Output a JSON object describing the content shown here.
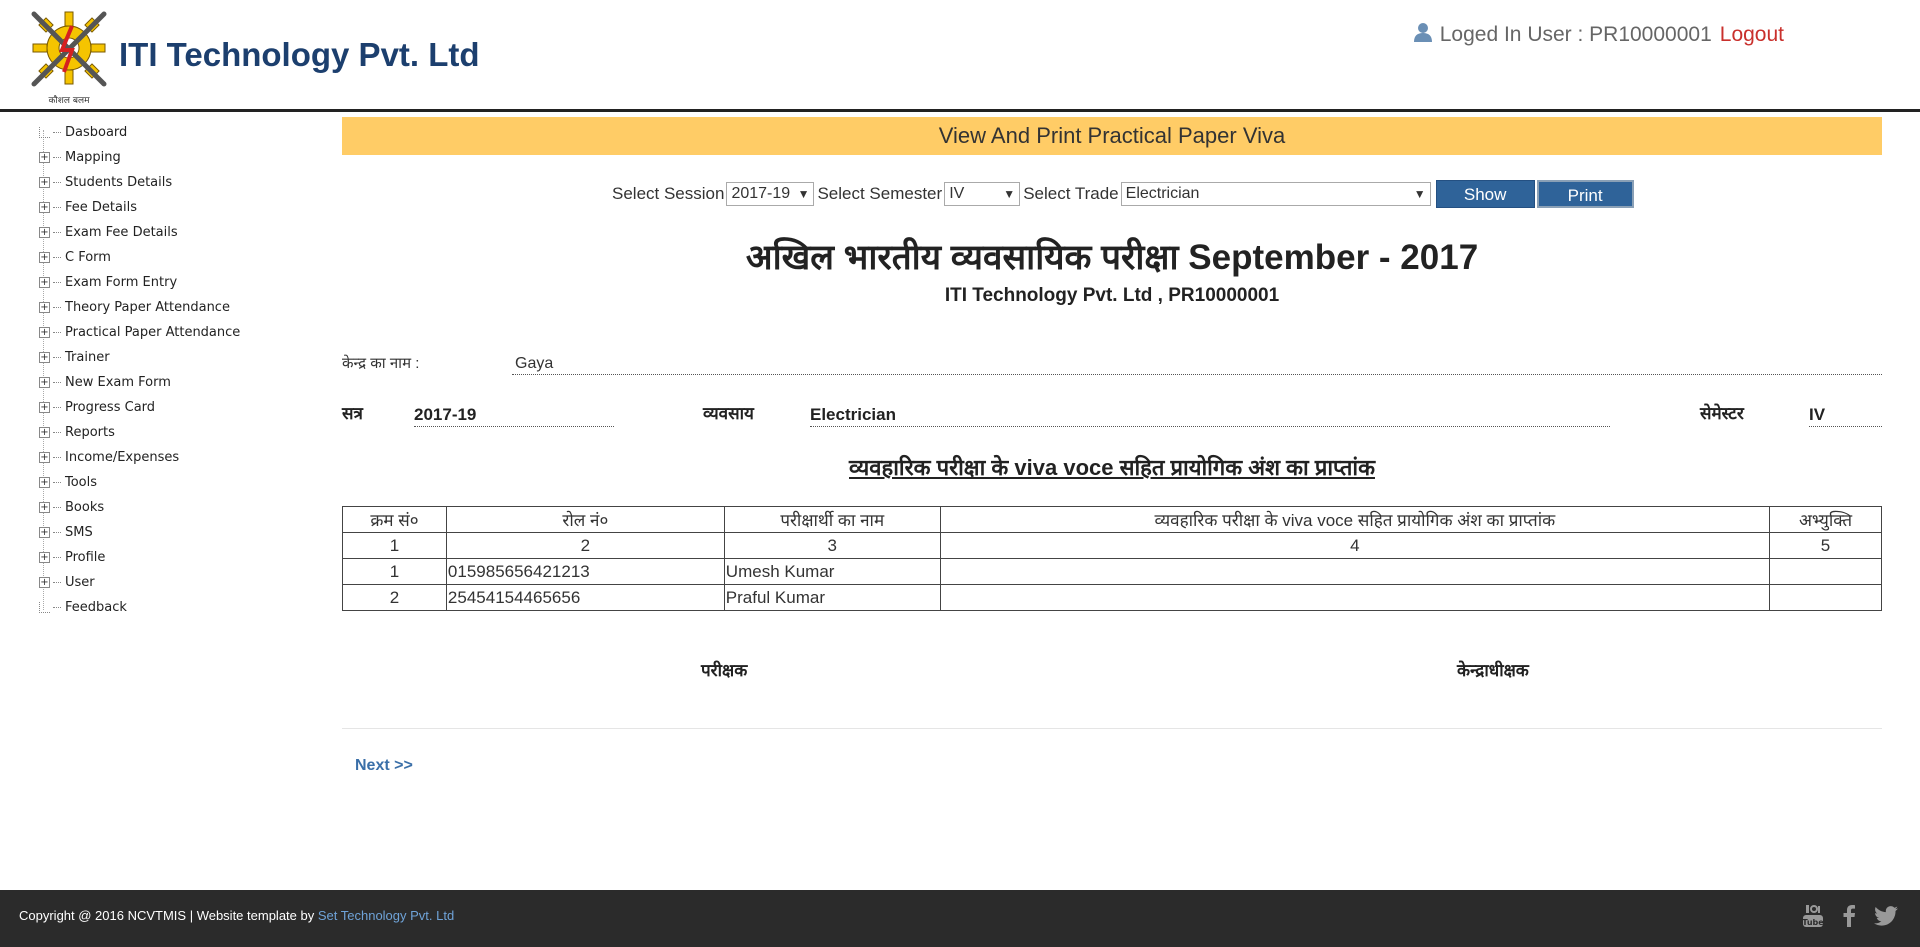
{
  "header": {
    "brand": "ITI Technology Pvt. Ltd",
    "logo_text": "कौशल बलम",
    "user_label": "Loged In User : PR10000001",
    "logout": "Logout"
  },
  "sidebar": {
    "items": [
      {
        "label": "Dasboard",
        "expandable": false
      },
      {
        "label": "Mapping",
        "expandable": true
      },
      {
        "label": "Students Details",
        "expandable": true
      },
      {
        "label": "Fee Details",
        "expandable": true
      },
      {
        "label": "Exam Fee Details",
        "expandable": true
      },
      {
        "label": "C Form",
        "expandable": true
      },
      {
        "label": "Exam Form Entry",
        "expandable": true
      },
      {
        "label": "Theory Paper Attendance",
        "expandable": true
      },
      {
        "label": "Practical Paper Attendance",
        "expandable": true
      },
      {
        "label": "Trainer",
        "expandable": true
      },
      {
        "label": "New Exam Form",
        "expandable": true
      },
      {
        "label": "Progress Card",
        "expandable": true
      },
      {
        "label": "Reports",
        "expandable": true
      },
      {
        "label": "Income/Expenses",
        "expandable": true
      },
      {
        "label": "Tools",
        "expandable": true
      },
      {
        "label": "Books",
        "expandable": true
      },
      {
        "label": "SMS",
        "expandable": true
      },
      {
        "label": "Profile",
        "expandable": true
      },
      {
        "label": "User",
        "expandable": true
      },
      {
        "label": "Feedback",
        "expandable": false
      }
    ]
  },
  "main": {
    "title": "View And Print Practical Paper Viva",
    "filters": {
      "session_label": "Select Session",
      "session_value": "2017-19",
      "semester_label": "Select Semester",
      "semester_value": "IV",
      "trade_label": "Select Trade",
      "trade_value": "Electrician",
      "show_button": "Show",
      "print_button": "Print"
    },
    "exam_title": "अखिल भारतीय व्यवसायिक परीक्षा September - 2017",
    "exam_subtitle": "ITI Technology Pvt. Ltd , PR10000001",
    "centre_label": "केन्द्र का नाम :",
    "centre_value": "Gaya",
    "session_label": "सत्र",
    "session_value": "2017-19",
    "trade_label": "व्यवसाय",
    "trade_value": "Electrician",
    "semester_label": "सेमेस्टर",
    "semester_value": "IV",
    "section_heading": "व्यवहारिक परीक्षा के viva voce सहित प्रायोगिक अंश का प्राप्तांक",
    "table": {
      "headers": [
        "क्रम सं०",
        "रोल नं०",
        "परीक्षार्थी का नाम",
        "व्यवहारिक परीक्षा के viva voce सहित प्रायोगिक अंश का प्राप्तांक",
        "अभ्युक्ति"
      ],
      "numbering": [
        "1",
        "2",
        "3",
        "4",
        "5"
      ],
      "rows": [
        {
          "sn": "1",
          "roll": "015985656421213",
          "name": "Umesh Kumar",
          "marks": "",
          "remarks": ""
        },
        {
          "sn": "2",
          "roll": "25454154465656",
          "name": "Praful Kumar",
          "marks": "",
          "remarks": ""
        }
      ]
    },
    "examiner_label": "परीक्षक",
    "superintendent_label": "केन्द्राधीक्षक",
    "next_link": "Next >>"
  },
  "footer": {
    "copyright": "Copyright @ 2016 NCVTMIS | Website template by",
    "template_link": "Set Technology Pvt. Ltd",
    "social_icons": [
      "youtube-icon",
      "facebook-icon",
      "twitter-icon"
    ]
  },
  "colors": {
    "title_bar": "#ffcc66",
    "brand": "#1c3f6e",
    "button": "#2f6399",
    "logout": "#c9302c",
    "footer_bg": "#2b2b2b",
    "link": "#3a6fa8"
  }
}
